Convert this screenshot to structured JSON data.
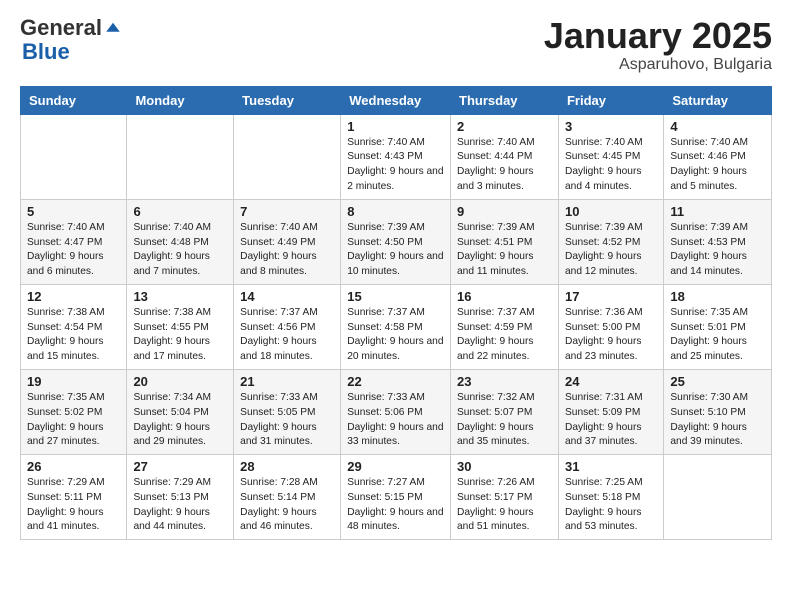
{
  "logo": {
    "general": "General",
    "blue": "Blue"
  },
  "title": "January 2025",
  "location": "Asparuhovo, Bulgaria",
  "days_of_week": [
    "Sunday",
    "Monday",
    "Tuesday",
    "Wednesday",
    "Thursday",
    "Friday",
    "Saturday"
  ],
  "weeks": [
    [
      {
        "num": "",
        "info": ""
      },
      {
        "num": "",
        "info": ""
      },
      {
        "num": "",
        "info": ""
      },
      {
        "num": "1",
        "info": "Sunrise: 7:40 AM\nSunset: 4:43 PM\nDaylight: 9 hours and 2 minutes."
      },
      {
        "num": "2",
        "info": "Sunrise: 7:40 AM\nSunset: 4:44 PM\nDaylight: 9 hours and 3 minutes."
      },
      {
        "num": "3",
        "info": "Sunrise: 7:40 AM\nSunset: 4:45 PM\nDaylight: 9 hours and 4 minutes."
      },
      {
        "num": "4",
        "info": "Sunrise: 7:40 AM\nSunset: 4:46 PM\nDaylight: 9 hours and 5 minutes."
      }
    ],
    [
      {
        "num": "5",
        "info": "Sunrise: 7:40 AM\nSunset: 4:47 PM\nDaylight: 9 hours and 6 minutes."
      },
      {
        "num": "6",
        "info": "Sunrise: 7:40 AM\nSunset: 4:48 PM\nDaylight: 9 hours and 7 minutes."
      },
      {
        "num": "7",
        "info": "Sunrise: 7:40 AM\nSunset: 4:49 PM\nDaylight: 9 hours and 8 minutes."
      },
      {
        "num": "8",
        "info": "Sunrise: 7:39 AM\nSunset: 4:50 PM\nDaylight: 9 hours and 10 minutes."
      },
      {
        "num": "9",
        "info": "Sunrise: 7:39 AM\nSunset: 4:51 PM\nDaylight: 9 hours and 11 minutes."
      },
      {
        "num": "10",
        "info": "Sunrise: 7:39 AM\nSunset: 4:52 PM\nDaylight: 9 hours and 12 minutes."
      },
      {
        "num": "11",
        "info": "Sunrise: 7:39 AM\nSunset: 4:53 PM\nDaylight: 9 hours and 14 minutes."
      }
    ],
    [
      {
        "num": "12",
        "info": "Sunrise: 7:38 AM\nSunset: 4:54 PM\nDaylight: 9 hours and 15 minutes."
      },
      {
        "num": "13",
        "info": "Sunrise: 7:38 AM\nSunset: 4:55 PM\nDaylight: 9 hours and 17 minutes."
      },
      {
        "num": "14",
        "info": "Sunrise: 7:37 AM\nSunset: 4:56 PM\nDaylight: 9 hours and 18 minutes."
      },
      {
        "num": "15",
        "info": "Sunrise: 7:37 AM\nSunset: 4:58 PM\nDaylight: 9 hours and 20 minutes."
      },
      {
        "num": "16",
        "info": "Sunrise: 7:37 AM\nSunset: 4:59 PM\nDaylight: 9 hours and 22 minutes."
      },
      {
        "num": "17",
        "info": "Sunrise: 7:36 AM\nSunset: 5:00 PM\nDaylight: 9 hours and 23 minutes."
      },
      {
        "num": "18",
        "info": "Sunrise: 7:35 AM\nSunset: 5:01 PM\nDaylight: 9 hours and 25 minutes."
      }
    ],
    [
      {
        "num": "19",
        "info": "Sunrise: 7:35 AM\nSunset: 5:02 PM\nDaylight: 9 hours and 27 minutes."
      },
      {
        "num": "20",
        "info": "Sunrise: 7:34 AM\nSunset: 5:04 PM\nDaylight: 9 hours and 29 minutes."
      },
      {
        "num": "21",
        "info": "Sunrise: 7:33 AM\nSunset: 5:05 PM\nDaylight: 9 hours and 31 minutes."
      },
      {
        "num": "22",
        "info": "Sunrise: 7:33 AM\nSunset: 5:06 PM\nDaylight: 9 hours and 33 minutes."
      },
      {
        "num": "23",
        "info": "Sunrise: 7:32 AM\nSunset: 5:07 PM\nDaylight: 9 hours and 35 minutes."
      },
      {
        "num": "24",
        "info": "Sunrise: 7:31 AM\nSunset: 5:09 PM\nDaylight: 9 hours and 37 minutes."
      },
      {
        "num": "25",
        "info": "Sunrise: 7:30 AM\nSunset: 5:10 PM\nDaylight: 9 hours and 39 minutes."
      }
    ],
    [
      {
        "num": "26",
        "info": "Sunrise: 7:29 AM\nSunset: 5:11 PM\nDaylight: 9 hours and 41 minutes."
      },
      {
        "num": "27",
        "info": "Sunrise: 7:29 AM\nSunset: 5:13 PM\nDaylight: 9 hours and 44 minutes."
      },
      {
        "num": "28",
        "info": "Sunrise: 7:28 AM\nSunset: 5:14 PM\nDaylight: 9 hours and 46 minutes."
      },
      {
        "num": "29",
        "info": "Sunrise: 7:27 AM\nSunset: 5:15 PM\nDaylight: 9 hours and 48 minutes."
      },
      {
        "num": "30",
        "info": "Sunrise: 7:26 AM\nSunset: 5:17 PM\nDaylight: 9 hours and 51 minutes."
      },
      {
        "num": "31",
        "info": "Sunrise: 7:25 AM\nSunset: 5:18 PM\nDaylight: 9 hours and 53 minutes."
      },
      {
        "num": "",
        "info": ""
      }
    ]
  ]
}
